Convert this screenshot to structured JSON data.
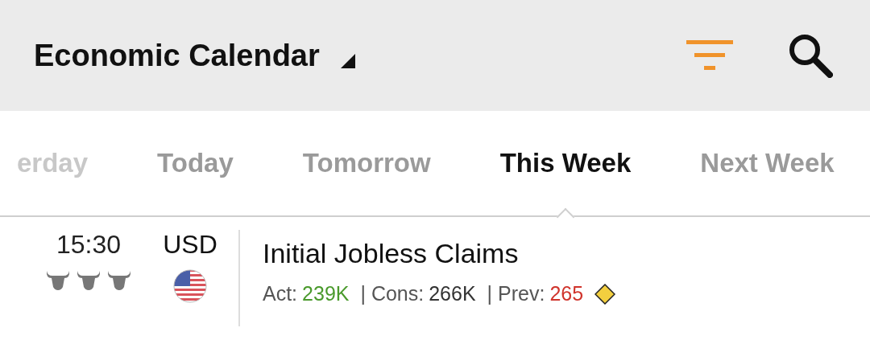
{
  "header": {
    "title": "Economic Calendar"
  },
  "tabs": [
    {
      "label": "erday",
      "selected": false
    },
    {
      "label": "Today",
      "selected": false
    },
    {
      "label": "Tomorrow",
      "selected": false
    },
    {
      "label": "This Week",
      "selected": true
    },
    {
      "label": "Next Week",
      "selected": false
    }
  ],
  "events": [
    {
      "time": "15:30",
      "currency": "USD",
      "stars": 3,
      "title": "Initial Jobless Claims",
      "stats": [
        {
          "label": "Act:",
          "value": "239K",
          "color": "#4a9a2c"
        },
        {
          "label": "| Cons:",
          "value": "266K",
          "color": "#333333"
        },
        {
          "label": "| Prev:",
          "value": "265",
          "color": "#d0342c"
        }
      ]
    }
  ]
}
